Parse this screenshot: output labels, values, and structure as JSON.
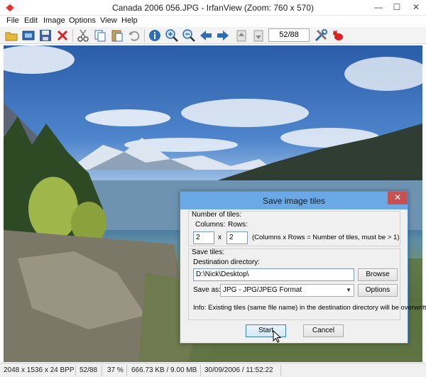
{
  "window": {
    "title": "Canada 2006 056.JPG - IrfanView (Zoom: 760 x 570)",
    "minimize": "—",
    "maximize": "☐",
    "close": "✕"
  },
  "menu": [
    "File",
    "Edit",
    "Image",
    "Options",
    "View",
    "Help"
  ],
  "toolbar": {
    "page_indicator": "52/88",
    "icons": [
      "open-folder-icon",
      "slideshow-icon",
      "save-icon",
      "delete-icon",
      "cut-icon",
      "copy-icon",
      "paste-icon",
      "undo-icon",
      "info-icon",
      "zoom-in-icon",
      "zoom-out-icon",
      "previous-icon",
      "next-icon",
      "first-icon",
      "last-icon",
      "settings-icon",
      "exit-icon"
    ]
  },
  "statusbar": {
    "dimensions": "2048 x 1536 x 24 BPP",
    "index": "52/88",
    "zoom": "37 %",
    "size": "666.73 KB / 9.00 MB",
    "datetime": "30/09/2006 / 11:52:22"
  },
  "dialog": {
    "title": "Save image tiles",
    "close": "✕",
    "tiles_group_label": "Number of tiles:",
    "columns_label": "Columns:",
    "rows_label": "Rows:",
    "columns_value": "2",
    "rows_value": "2",
    "x_label": "x",
    "hint": "(Columns x Rows = Number of tiles, must be > 1)",
    "save_group_label": "Save tiles:",
    "dest_label": "Destination directory:",
    "dest_value": "D:\\Nick\\Desktop\\",
    "browse_label": "Browse",
    "save_as_label": "Save as:",
    "format_value": "JPG - JPG/JPEG Format",
    "options_label": "Options",
    "info": "Info: Existing tiles (same file name) in the destination directory will be overwritten!",
    "start_label": "Start",
    "cancel_label": "Cancel"
  },
  "colors": {
    "dialog_title": "#6aa8e6",
    "close_red": "#c75050",
    "focus_border": "#3c7fb1"
  }
}
